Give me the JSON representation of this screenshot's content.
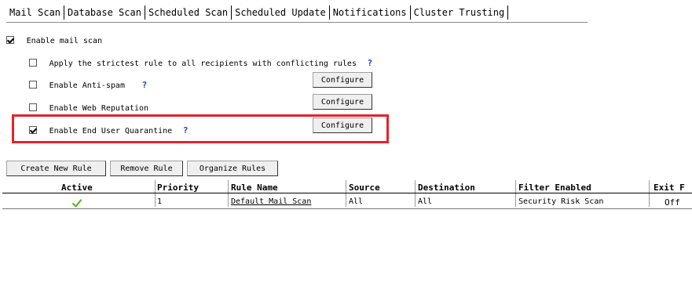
{
  "tabs": [
    "Mail Scan",
    "Database Scan",
    "Scheduled Scan",
    "Scheduled Update",
    "Notifications",
    "Cluster Trusting"
  ],
  "options": {
    "enable_mail_scan": {
      "label": "Enable mail scan",
      "checked": true
    },
    "strictest_rule": {
      "label": "Apply the strictest rule to all recipients with conflicting rules",
      "checked": false
    },
    "anti_spam": {
      "label": "Enable Anti-spam",
      "checked": false
    },
    "web_reputation": {
      "label": "Enable Web Reputation",
      "checked": false
    },
    "end_user_quarantine": {
      "label": "Enable End User Quarantine",
      "checked": true
    }
  },
  "help_symbol": "?",
  "configure_label": "Configure",
  "rule_buttons": {
    "create": "Create New Rule",
    "remove": "Remove Rule",
    "organize": "Organize Rules"
  },
  "table": {
    "columns": [
      "Active",
      "Priority",
      "Rule Name",
      "Source",
      "Destination",
      "Filter Enabled",
      "Exit F"
    ],
    "rows": [
      {
        "active_icon": "green-check-icon",
        "priority": "1",
        "rule_name": "Default Mail Scan",
        "source": "All",
        "destination": "All",
        "filter_enabled": "Security Risk Scan",
        "exit": "Off"
      }
    ]
  },
  "colors": {
    "highlight_border": "#e8202a",
    "help_icon": "#1a3fd1",
    "check_icon": "#5cb82a"
  }
}
